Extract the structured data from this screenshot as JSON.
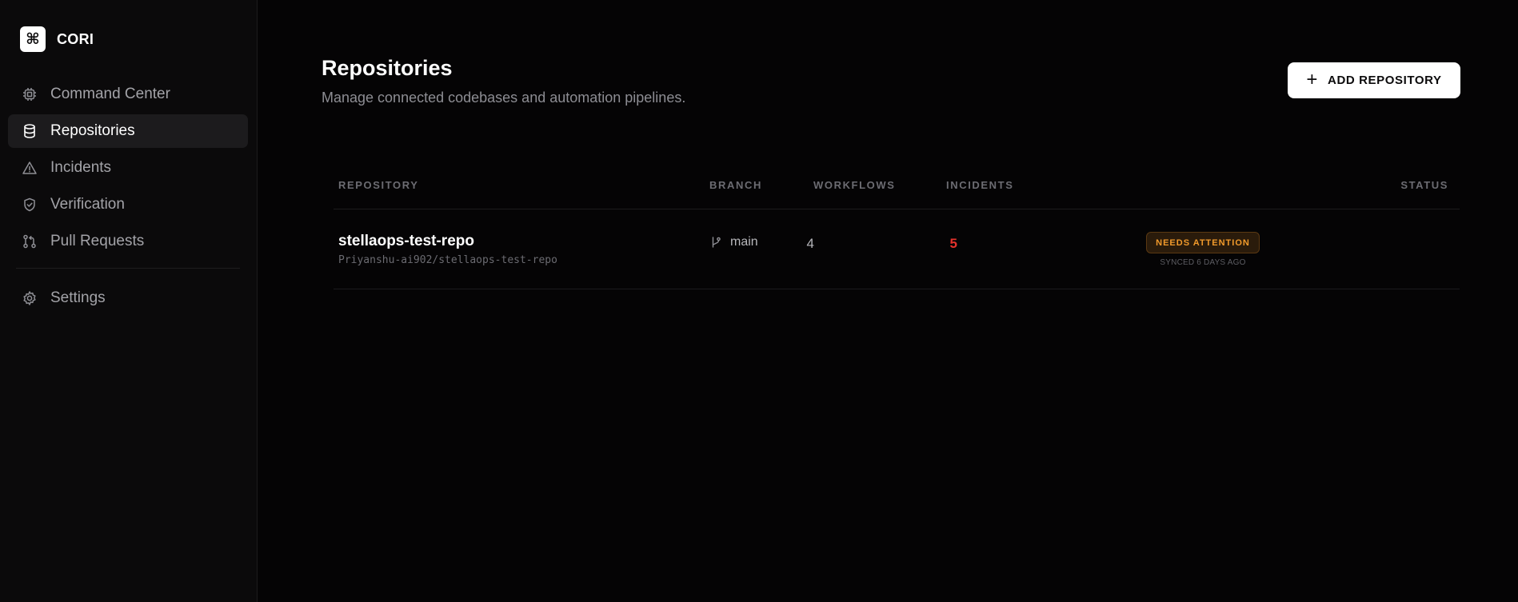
{
  "brand": {
    "logo_glyph": "⌘",
    "name": "CORI"
  },
  "sidebar": {
    "items": [
      {
        "label": "Command Center",
        "icon": "cpu-icon",
        "active": false
      },
      {
        "label": "Repositories",
        "icon": "database-icon",
        "active": true
      },
      {
        "label": "Incidents",
        "icon": "warning-triangle-icon",
        "active": false
      },
      {
        "label": "Verification",
        "icon": "shield-icon",
        "active": false
      },
      {
        "label": "Pull Requests",
        "icon": "git-pull-request-icon",
        "active": false
      }
    ],
    "footer_items": [
      {
        "label": "Settings",
        "icon": "gear-icon",
        "active": false
      }
    ]
  },
  "header": {
    "title": "Repositories",
    "subtitle": "Manage connected codebases and automation pipelines.",
    "add_button_label": "ADD REPOSITORY"
  },
  "table": {
    "columns": {
      "repository": "REPOSITORY",
      "branch": "BRANCH",
      "workflows": "WORKFLOWS",
      "incidents": "INCIDENTS",
      "status": "STATUS"
    },
    "rows": [
      {
        "name": "stellaops-test-repo",
        "path": "Priyanshu-ai902/stellaops-test-repo",
        "branch": "main",
        "workflows": "4",
        "incidents": "5",
        "status": "NEEDS ATTENTION",
        "synced": "SYNCED 6 DAYS AGO"
      }
    ]
  },
  "colors": {
    "background": "#050405",
    "sidebar": "#0b0a0b",
    "incidents_count": "#e5322c",
    "status_warning": "#f19a2b"
  }
}
